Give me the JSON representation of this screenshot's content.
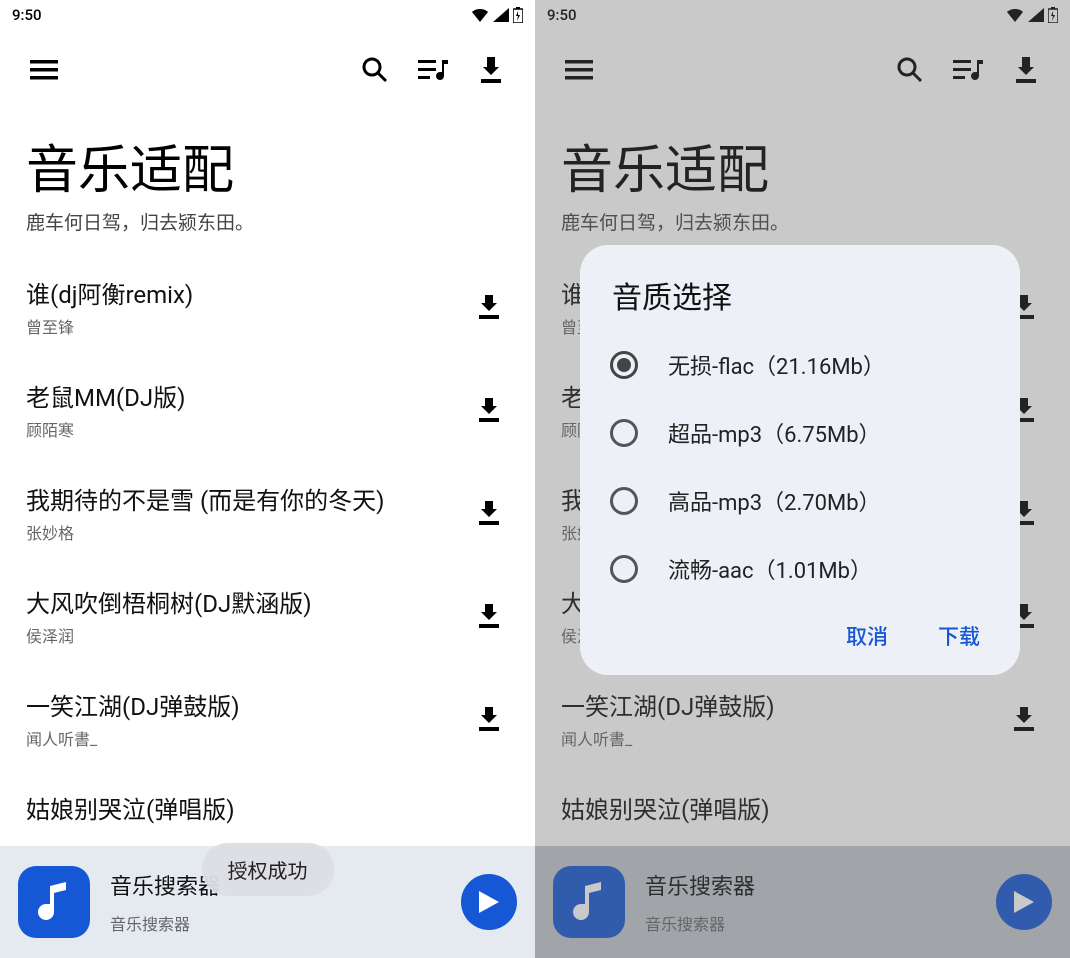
{
  "status": {
    "time": "9:50"
  },
  "header": {
    "title": "音乐适配",
    "subtitle": "鹿车何日驾，归去颍东田。"
  },
  "songs": [
    {
      "title": "谁(dj阿衡remix)",
      "artist": "曾至锋"
    },
    {
      "title": "老鼠MM(DJ版)",
      "artist": "顾陌寒"
    },
    {
      "title": "我期待的不是雪 (而是有你的冬天)",
      "artist": "张妙格"
    },
    {
      "title": "大风吹倒梧桐树(DJ默涵版)",
      "artist": "侯泽润"
    },
    {
      "title": "一笑江湖(DJ弹鼓版)",
      "artist": "闻人听書_"
    }
  ],
  "partial_song": "姑娘别哭泣(弹唱版)",
  "bottom": {
    "title_left": "音乐搜索器",
    "title_right": "音乐搜索器",
    "subtitle": "音乐搜索器"
  },
  "toast": "授权成功",
  "dialog": {
    "title": "音质选择",
    "options": [
      "无损-flac（21.16Mb）",
      "超品-mp3（6.75Mb）",
      "高品-mp3（2.70Mb）",
      "流畅-aac（1.01Mb）"
    ],
    "cancel": "取消",
    "confirm": "下载"
  }
}
